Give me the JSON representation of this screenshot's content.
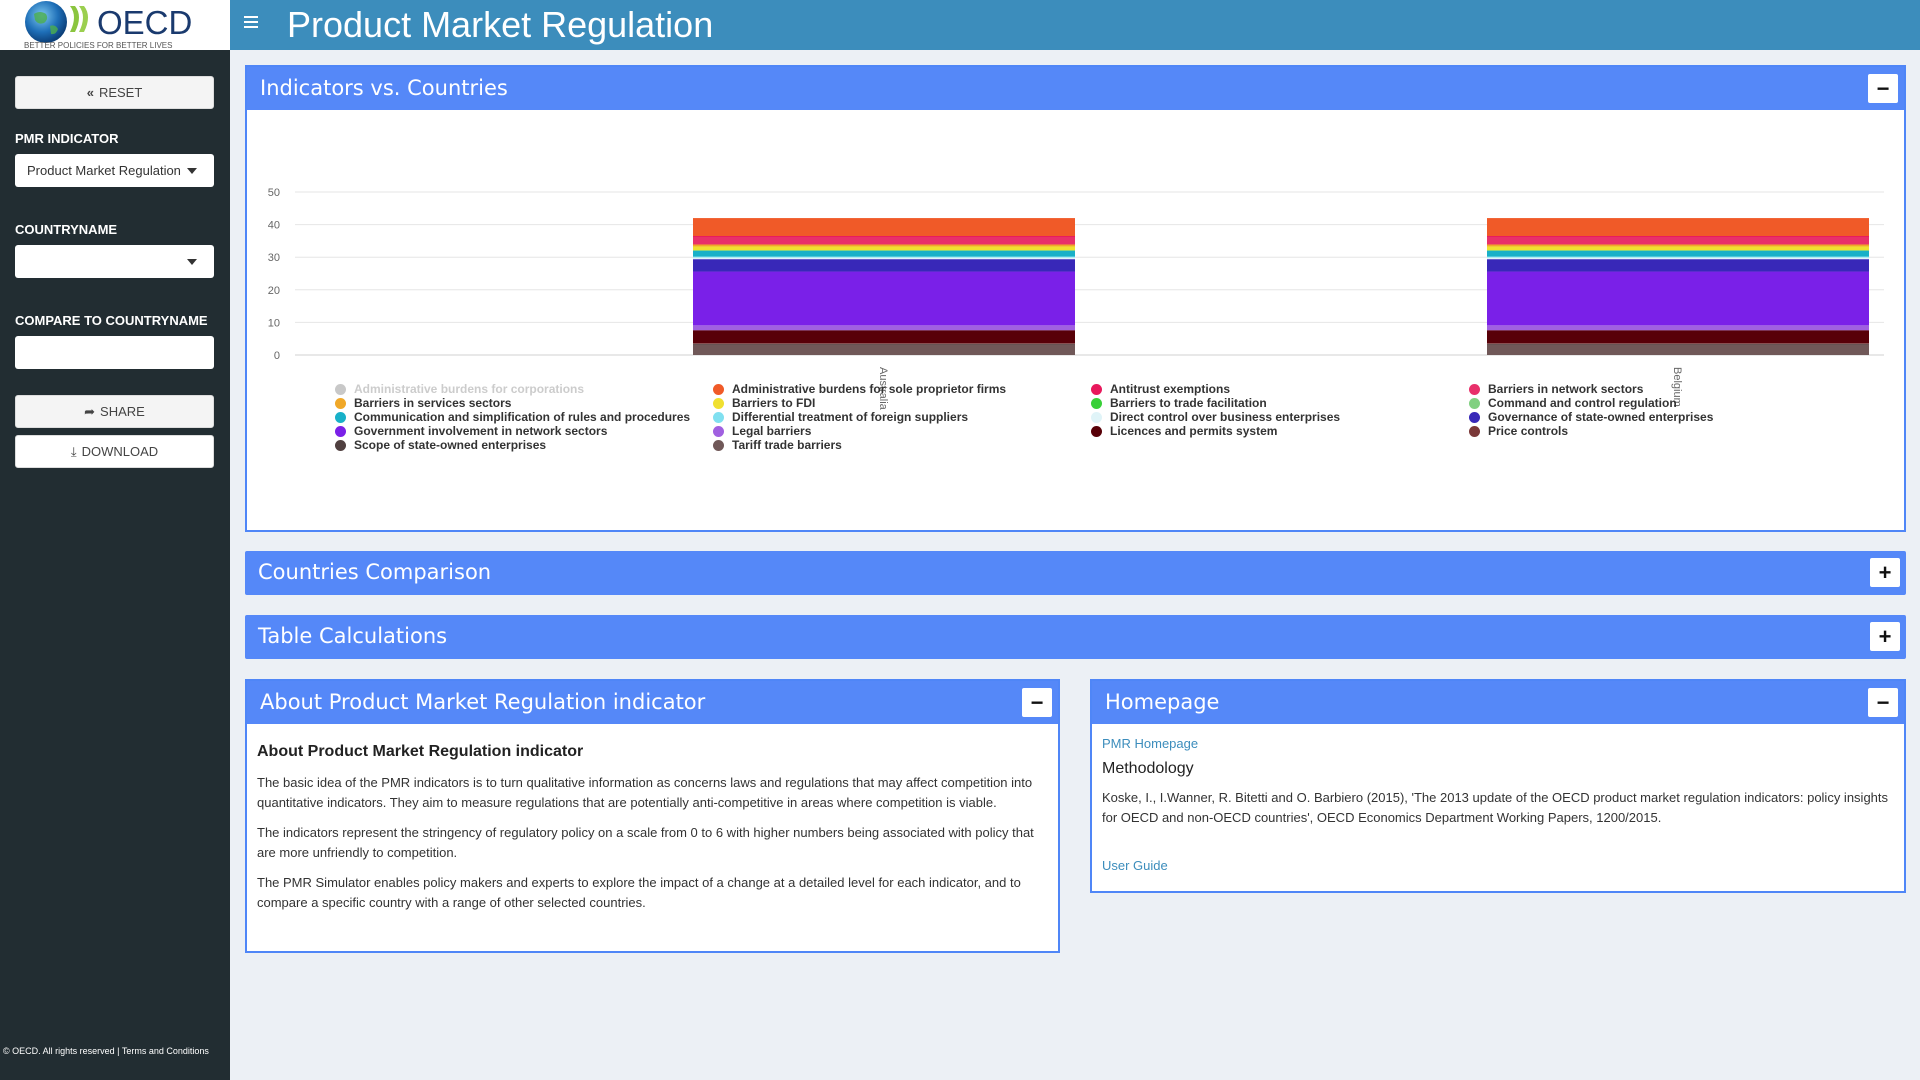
{
  "header": {
    "logo_text": "OECD",
    "logo_tagline": "BETTER POLICIES FOR BETTER LIVES",
    "title": "Product Market Regulation"
  },
  "sidebar": {
    "reset_label": "RESET",
    "pmr_indicator_label": "PMR INDICATOR",
    "pmr_indicator_value": "Product Market Regulation",
    "countryname_label": "COUNTRYNAME",
    "countryname_value": "",
    "compare_label": "COMPARE TO COUNTRYNAME",
    "compare_value": "",
    "share_label": "SHARE",
    "download_label": "DOWNLOAD",
    "footer": "© OECD. All rights reserved | Terms and Conditions"
  },
  "panels": {
    "indicators_title": "Indicators vs. Countries",
    "comparison_title": "Countries Comparison",
    "table_title": "Table Calculations",
    "about_title": "About Product Market Regulation indicator",
    "homepage_title": "Homepage"
  },
  "about": {
    "heading": "About Product Market Regulation indicator",
    "p1": "The basic idea of the PMR indicators is to turn qualitative information as concerns laws and regulations that may affect competition into quantitative indicators. They aim to measure regulations that are potentially anti-competitive in areas where competition is viable.",
    "p2": "The indicators represent the stringency of regulatory policy on a scale from 0 to 6 with higher numbers being associated with policy that are more unfriendly to competition.",
    "p3": "The PMR Simulator enables policy makers and experts to explore the impact of a change at a detailed level for each indicator, and to compare a specific country with a range of other selected countries."
  },
  "homepage": {
    "pmr_link": "PMR Homepage",
    "methodology_heading": "Methodology",
    "citation": "Koske, I., I.Wanner, R. Bitetti and O. Barbiero (2015), 'The 2013 update of the OECD product market regulation indicators: policy insights for OECD and non-OECD countries', OECD Economics Department Working Papers, 1200/2015.",
    "user_guide_link": "User Guide"
  },
  "chart_data": {
    "type": "bar",
    "stacked": true,
    "categories": [
      "Australia",
      "Belgium"
    ],
    "ylim": [
      0,
      50
    ],
    "yticks": [
      0,
      10,
      20,
      30,
      40,
      50
    ],
    "grid": true,
    "legend_position": "bottom",
    "series": [
      {
        "name": "Administrative burdens for corporations",
        "color": "#c8c8c8",
        "visible": false,
        "values": [
          0,
          0
        ]
      },
      {
        "name": "Administrative burdens for sole proprietor firms",
        "color": "#f05a28",
        "values": [
          5.5,
          5.5
        ]
      },
      {
        "name": "Antitrust exemptions",
        "color": "#e8185c",
        "values": [
          0.3,
          0.3
        ]
      },
      {
        "name": "Barriers in network sectors",
        "color": "#e8306a",
        "values": [
          2.3,
          2.3
        ]
      },
      {
        "name": "Barriers in services sectors",
        "color": "#f0a828",
        "values": [
          0.6,
          0.6
        ]
      },
      {
        "name": "Barriers to FDI",
        "color": "#f0e030",
        "values": [
          1.1,
          1.1
        ]
      },
      {
        "name": "Barriers to trade facilitation",
        "color": "#38d038",
        "values": [
          0,
          0
        ]
      },
      {
        "name": "Command and control regulation",
        "color": "#80d080",
        "values": [
          0.3,
          0.3
        ]
      },
      {
        "name": "Communication and simplification of rules and procedures",
        "color": "#18b0c8",
        "values": [
          1.7,
          1.7
        ]
      },
      {
        "name": "Differential treatment of foreign suppliers",
        "color": "#80e0f0",
        "values": [
          0.3,
          0.3
        ]
      },
      {
        "name": "Direct control over business enterprises",
        "color": "#e0f4f8",
        "values": [
          0.5,
          0.5
        ]
      },
      {
        "name": "Governance of state-owned enterprises",
        "color": "#3828b8",
        "values": [
          3.8,
          3.8
        ]
      },
      {
        "name": "Government involvement in network sectors",
        "color": "#7a20e8",
        "values": [
          16.5,
          16.5
        ]
      },
      {
        "name": "Legal barriers",
        "color": "#a060e0",
        "values": [
          1.5,
          1.5
        ]
      },
      {
        "name": "Licences and permits system",
        "color": "#580008",
        "values": [
          4.0,
          4.0
        ]
      },
      {
        "name": "Price controls",
        "color": "#7a3838",
        "values": [
          0.2,
          0.2
        ]
      },
      {
        "name": "Scope of state-owned enterprises",
        "color": "#504040",
        "values": [
          0.2,
          0.2
        ]
      },
      {
        "name": "Tariff trade barriers",
        "color": "#705858",
        "values": [
          3.2,
          3.2
        ]
      }
    ]
  }
}
